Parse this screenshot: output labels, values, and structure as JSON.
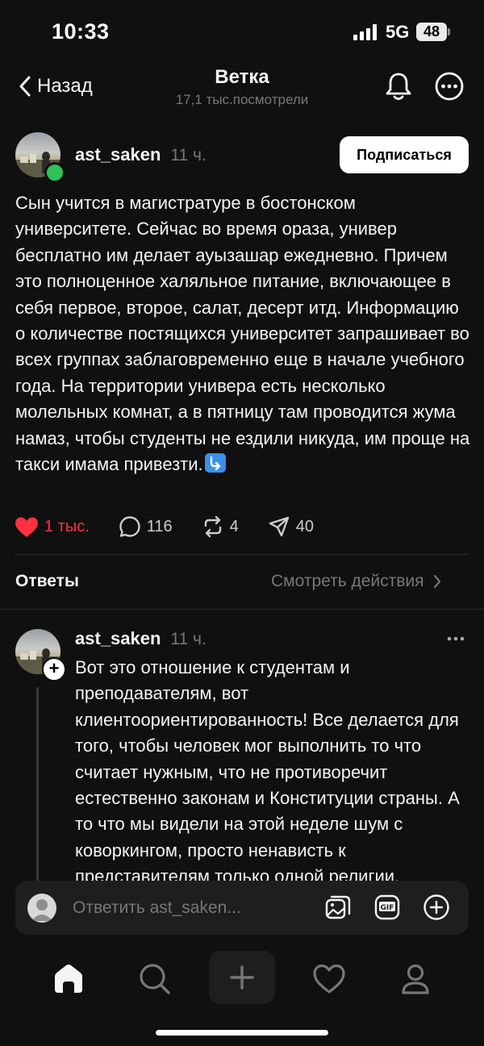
{
  "status_bar": {
    "time": "10:33",
    "network": "5G",
    "battery": "48"
  },
  "header": {
    "back_label": "Назад",
    "title": "Ветка",
    "subtitle": "17,1 тыс.посмотрели",
    "icons": [
      "bell-icon",
      "more-icon"
    ]
  },
  "post": {
    "username": "ast_saken",
    "time_ago": "11 ч.",
    "subscribe_label": "Подписаться",
    "text": "Сын учится в магистратуре в бостонском университете. Сейчас во время ораза, универ бесплатно им делает ауызашар ежедневно. Причем это полноценное халяльное питание, включающее в себя первое, второе, салат, десерт итд. Информацию о количестве постящихся университет запрашивает во всех группах заблаговременно еще в начале учебного года. На территории универа есть несколько молельных комнат, а в пятницу там проводится жума намаз, чтобы студенты не ездили никуда, им проще на такси имама привезти.",
    "emoji": "down-right-arrow-emoji",
    "likes": "1 тыс.",
    "comments": "116",
    "reposts": "4",
    "shares": "40",
    "like_color": "#ff3040"
  },
  "answers_bar": {
    "label": "Ответы",
    "view_actions": "Смотреть действия"
  },
  "reply": {
    "username": "ast_saken",
    "time_ago": "11 ч.",
    "text": "Вот это отношение к студентам и преподавателям, вот клиентоориентированность! Все делается для того, чтобы человек мог выполнить то что считает нужным, что не противоречит естественно законам и Конституции страны. А то что мы видели на этой неделе шум с коворкингом, просто ненависть к представителям только одной религии."
  },
  "composer": {
    "placeholder": "Ответить ast_saken...",
    "icons": [
      "gallery-icon",
      "gif-icon",
      "add-icon"
    ]
  },
  "tab_bar": [
    "home-icon",
    "search-icon",
    "create-icon",
    "activity-heart-icon",
    "profile-icon"
  ]
}
